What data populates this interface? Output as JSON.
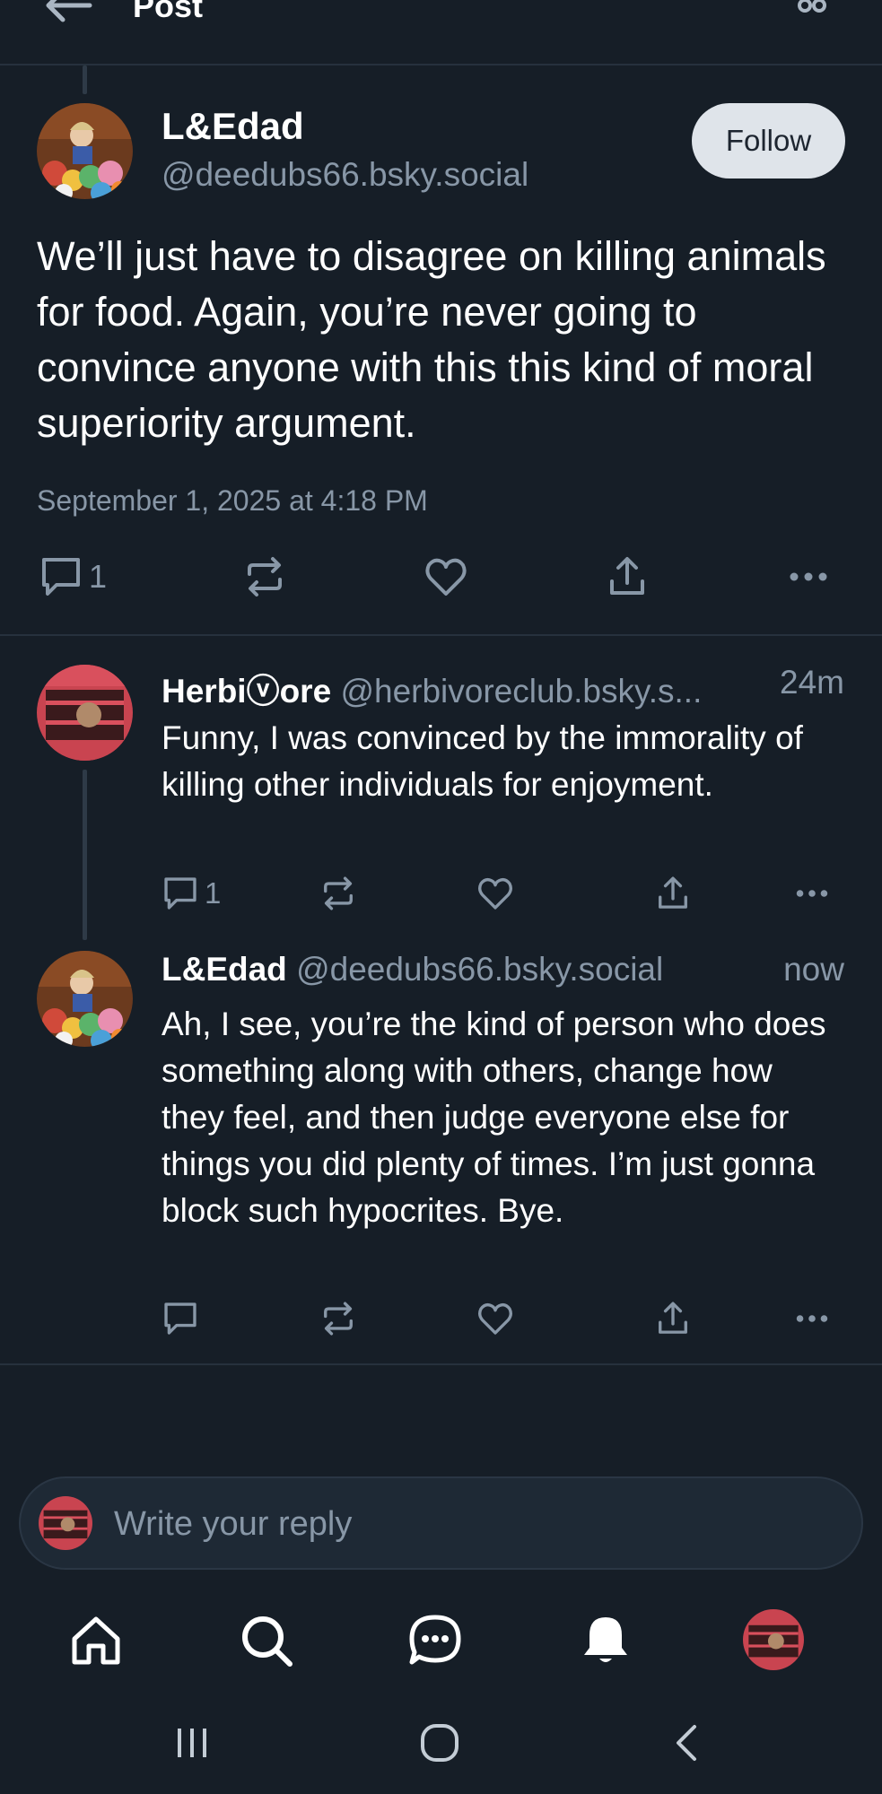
{
  "header": {
    "title": "Post"
  },
  "main_post": {
    "author_name": "L&Edad",
    "author_handle": "@deedubs66.bsky.social",
    "follow_label": "Follow",
    "text": "We’ll just have to disagree on killing animals for food. Again, you’re never going to convince anyone with this this kind of moral superiority argument.",
    "date": "September 1, 2025 at 4:18 PM",
    "reply_count": "1"
  },
  "replies": [
    {
      "author_name": "Herbiⓥore",
      "author_handle": "@herbivoreclub.bsky.s...",
      "time": "24m",
      "text": "Funny, I was convinced by the immorality of killing other individuals for enjoyment.",
      "reply_count": "1"
    },
    {
      "author_name": "L&Edad",
      "author_handle": "@deedubs66.bsky.social",
      "time": "now",
      "text": "Ah, I see, you’re the kind of person who does something along with others, change how they feel, and then judge everyone else for things you did plenty of times. I’m just gonna block such hypocrites. Bye.",
      "reply_count": ""
    }
  ],
  "composer": {
    "placeholder": "Write your reply"
  },
  "icons": {
    "reply": "comment-icon",
    "repost": "repost-icon",
    "like": "heart-icon",
    "share": "share-icon",
    "more": "more-icon"
  },
  "colors": {
    "background": "#161e27",
    "muted": "#8897a7",
    "divider": "#26313d",
    "follow_bg": "#dfe4ea"
  }
}
